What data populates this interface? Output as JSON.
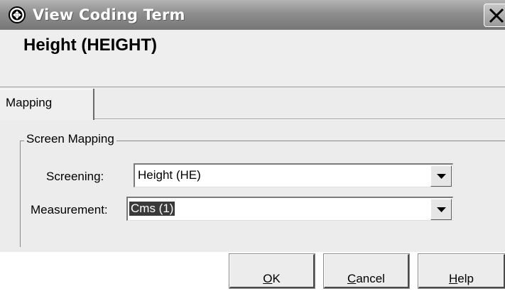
{
  "window": {
    "title": "View Coding Term",
    "app_icon": "circle-cross-icon",
    "close_icon": "close-icon"
  },
  "header": {
    "heading": "Height (HEIGHT)"
  },
  "tabs": [
    {
      "label": "Mapping",
      "selected": true
    }
  ],
  "screen_mapping": {
    "group_label": "Screen Mapping",
    "screening": {
      "label": "Screening:",
      "value": "Height (HE)"
    },
    "measurement": {
      "label": "Measurement:",
      "value": "Cms (1)"
    }
  },
  "buttons": {
    "ok": {
      "mnemonic": "O",
      "rest": "K"
    },
    "cancel": {
      "mnemonic": "C",
      "rest": "ancel"
    },
    "help": {
      "mnemonic": "H",
      "rest": "elp"
    }
  },
  "colors": {
    "titlebar": "#8e8e8e",
    "dialog_bg": "#ececec",
    "selection": "#3a3a3a"
  }
}
